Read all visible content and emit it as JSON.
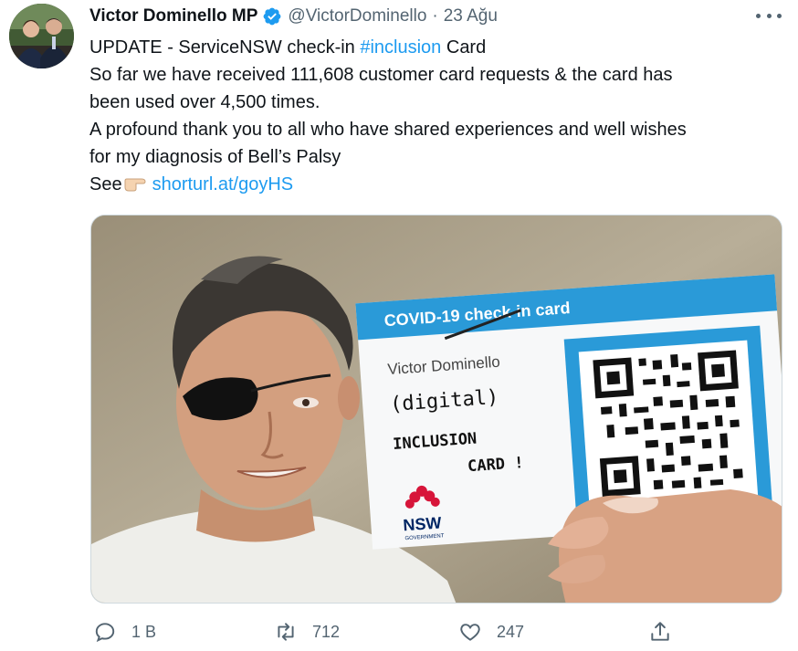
{
  "tweet": {
    "author_name": "Victor Dominello MP",
    "handle": "@VictorDominello",
    "separator": "·",
    "date": "23 Ağu",
    "text": {
      "line1_prefix": "UPDATE - ServiceNSW check-in ",
      "line1_hashtag": "#inclusion",
      "line1_suffix": " Card",
      "line2": "So far we have received 111,608 customer card requests & the card has",
      "line3": "been used over 4,500 times.",
      "line4": "A profound thank you to all who have shared experiences and well wishes",
      "line5": "for my diagnosis of Bell’s Palsy",
      "line6_prefix": "See",
      "line6_link": "shorturl.at/goyHS"
    },
    "media": {
      "card_title": "COVID-19 check-in card",
      "card_name": "Victor Dominello",
      "card_handwritten_1": "(digital)",
      "card_handwritten_2": "INCLUSION",
      "card_handwritten_3": "CARD !",
      "logo_text": "NSW",
      "logo_subtext": "GOVERNMENT"
    },
    "actions": {
      "replies": "1 B",
      "retweets": "712",
      "likes": "247"
    }
  },
  "colors": {
    "link": "#1d9bf0",
    "verified": "#1d9bf0",
    "muted": "#536471",
    "card_blue": "#2a9ad8",
    "nsw_red": "#d7153a",
    "nsw_navy": "#002664"
  },
  "icons": {
    "verified": "verified-badge-icon",
    "more": "more-options-icon",
    "reply": "reply-icon",
    "retweet": "retweet-icon",
    "like": "heart-icon",
    "share": "share-icon",
    "pointing": "pointing-right-emoji"
  }
}
